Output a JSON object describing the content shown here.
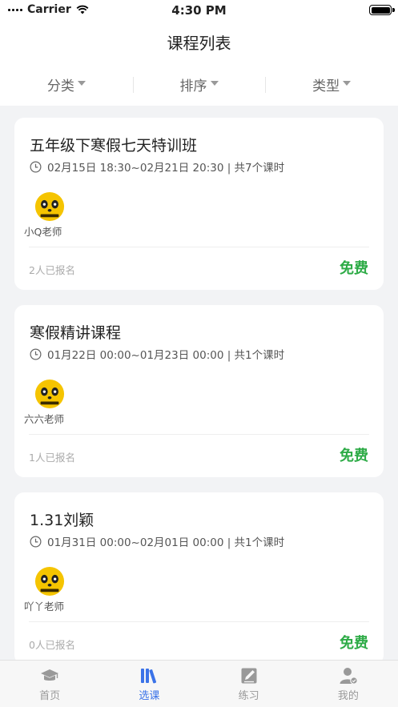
{
  "status_bar": {
    "carrier": "Carrier",
    "time": "4:30 PM"
  },
  "nav": {
    "title": "课程列表"
  },
  "filters": [
    {
      "label": "分类"
    },
    {
      "label": "排序"
    },
    {
      "label": "类型"
    }
  ],
  "courses": [
    {
      "title": "五年级下寒假七天特训班",
      "time": "02月15日 18:30~02月21日 20:30 | 共7个课时",
      "teacher": "小Q老师",
      "enrolled": "2人已报名",
      "price": "免费"
    },
    {
      "title": "寒假精讲课程",
      "time": "01月22日 00:00~01月23日 00:00 | 共1个课时",
      "teacher": "六六老师",
      "enrolled": "1人已报名",
      "price": "免费"
    },
    {
      "title": "1.31刘颖",
      "time": "01月31日 00:00~02月01日 00:00 | 共1个课时",
      "teacher": "吖丫老师",
      "enrolled": "0人已报名",
      "price": "免费"
    }
  ],
  "tabs": [
    {
      "label": "首页",
      "icon": "graduation-cap-icon",
      "active": false
    },
    {
      "label": "选课",
      "icon": "books-icon",
      "active": true
    },
    {
      "label": "练习",
      "icon": "edit-icon",
      "active": false
    },
    {
      "label": "我的",
      "icon": "user-icon",
      "active": false
    }
  ],
  "colors": {
    "price": "#2dab46",
    "active_tab": "#3b73e8",
    "inactive_tab": "#999999",
    "avatar": "#f5c400"
  }
}
